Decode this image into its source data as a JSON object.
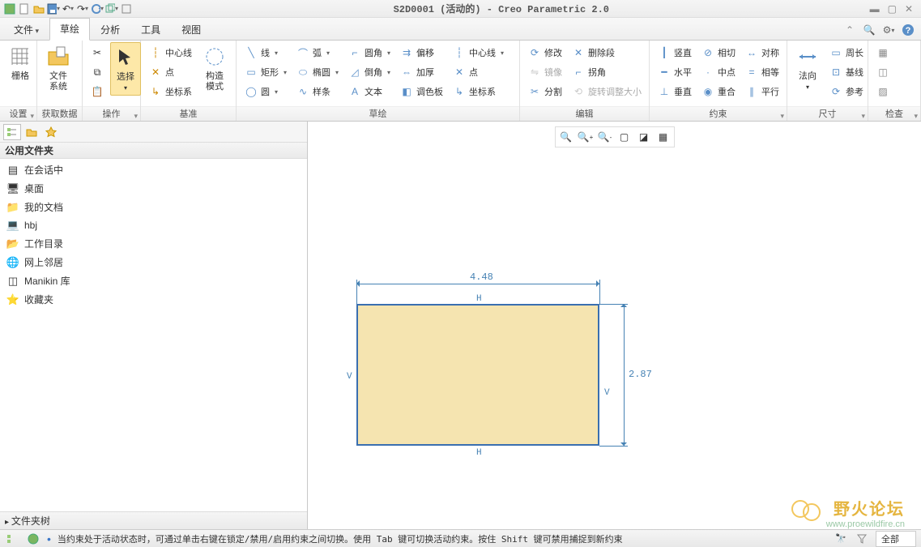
{
  "title": "S2D0001 (活动的) - Creo Parametric 2.0",
  "tabs": [
    "文件",
    "草绘",
    "分析",
    "工具",
    "视图"
  ],
  "active_tab_index": 1,
  "ribbon": {
    "groups": [
      {
        "label": "设置",
        "items_big": [
          {
            "name": "grid",
            "label": "栅格"
          }
        ]
      },
      {
        "label": "获取数据",
        "items_big": [
          {
            "name": "file-system",
            "label": "文件\n系统"
          }
        ]
      },
      {
        "label": "操作",
        "items_big": [
          {
            "name": "select",
            "label": "选择"
          }
        ],
        "small_col": [
          {
            "name": "cut",
            "icon": "✂"
          },
          {
            "name": "copy",
            "icon": "⧉"
          },
          {
            "name": "paste",
            "icon": "📋"
          }
        ]
      },
      {
        "label": "基准",
        "col1": [
          {
            "name": "centerline",
            "label": "中心线",
            "icon": "┆"
          },
          {
            "name": "point",
            "label": "点",
            "icon": "✕"
          },
          {
            "name": "coord-sys",
            "label": "坐标系",
            "icon": "↳"
          }
        ],
        "big": {
          "name": "construct-mode",
          "label": "构造\n模式"
        }
      },
      {
        "label": "草绘",
        "cols": [
          [
            {
              "name": "line",
              "label": "线",
              "icon": "╲",
              "dd": true
            },
            {
              "name": "rect",
              "label": "矩形",
              "icon": "▭",
              "dd": true
            },
            {
              "name": "circle",
              "label": "圆",
              "icon": "◯",
              "dd": true
            }
          ],
          [
            {
              "name": "arc",
              "label": "弧",
              "icon": "⌒",
              "dd": true
            },
            {
              "name": "ellipse",
              "label": "椭圆",
              "icon": "⬭",
              "dd": true
            },
            {
              "name": "spline",
              "label": "样条",
              "icon": "∿"
            }
          ],
          [
            {
              "name": "fillet",
              "label": "圆角",
              "icon": "⌐",
              "dd": true
            },
            {
              "name": "chamfer",
              "label": "倒角",
              "icon": "◿",
              "dd": true
            },
            {
              "name": "text",
              "label": "文本",
              "icon": "A"
            }
          ],
          [
            {
              "name": "offset",
              "label": "偏移",
              "icon": "⇉"
            },
            {
              "name": "thicken",
              "label": "加厚",
              "icon": "⇔"
            },
            {
              "name": "palette",
              "label": "调色板",
              "icon": "◧"
            }
          ],
          [
            {
              "name": "centerline2",
              "label": "中心线",
              "icon": "┆",
              "dd": true
            },
            {
              "name": "point2",
              "label": "点",
              "icon": "✕"
            },
            {
              "name": "coord2",
              "label": "坐标系",
              "icon": "↳"
            }
          ]
        ]
      },
      {
        "label": "编辑",
        "cols": [
          [
            {
              "name": "modify",
              "label": "修改",
              "icon": "⟳"
            },
            {
              "name": "mirror",
              "label": "镜像",
              "icon": "⇋",
              "disabled": true
            },
            {
              "name": "divide",
              "label": "分割",
              "icon": "✂"
            }
          ],
          [
            {
              "name": "delete-seg",
              "label": "删除段",
              "icon": "✕"
            },
            {
              "name": "corner",
              "label": "拐角",
              "icon": "⌐"
            },
            {
              "name": "rotate-resize",
              "label": "旋转调整大小",
              "icon": "⟲",
              "disabled": true
            }
          ]
        ]
      },
      {
        "label": "约束",
        "cols": [
          [
            {
              "name": "vertical",
              "label": "竖直",
              "icon": "┃"
            },
            {
              "name": "horizontal",
              "label": "水平",
              "icon": "━"
            },
            {
              "name": "perpendicular",
              "label": "垂直",
              "icon": "⊥"
            }
          ],
          [
            {
              "name": "tangent",
              "label": "相切",
              "icon": "⊘"
            },
            {
              "name": "midpoint",
              "label": "中点",
              "icon": "·"
            },
            {
              "name": "coincident",
              "label": "重合",
              "icon": "◉"
            }
          ],
          [
            {
              "name": "symmetric",
              "label": "对称",
              "icon": "↔"
            },
            {
              "name": "equal",
              "label": "相等",
              "icon": "="
            },
            {
              "name": "parallel",
              "label": "平行",
              "icon": "∥"
            }
          ]
        ]
      },
      {
        "label": "尺寸",
        "big": {
          "name": "normal-dim",
          "label": "法向"
        },
        "col": [
          {
            "name": "perimeter",
            "label": "周长",
            "icon": "▭"
          },
          {
            "name": "baseline",
            "label": "基线",
            "icon": "⊡"
          },
          {
            "name": "reference",
            "label": "参考",
            "icon": "⟳"
          }
        ]
      },
      {
        "label": "检查",
        "col": [
          {
            "name": "inspect1",
            "icon": "▦"
          },
          {
            "name": "inspect2",
            "icon": "◫"
          },
          {
            "name": "inspect3",
            "icon": "▨"
          }
        ]
      }
    ]
  },
  "sidebar": {
    "header": "公用文件夹",
    "items": [
      {
        "name": "in-session",
        "label": "在会话中",
        "icon": "▤"
      },
      {
        "name": "desktop",
        "label": "桌面",
        "icon": "🖥"
      },
      {
        "name": "my-docs",
        "label": "我的文档",
        "icon": "📁"
      },
      {
        "name": "hbj",
        "label": "hbj",
        "icon": "💻"
      },
      {
        "name": "working-dir",
        "label": "工作目录",
        "icon": "📂"
      },
      {
        "name": "network",
        "label": "网上邻居",
        "icon": "🌐"
      },
      {
        "name": "manikin",
        "label": "Manikin 库",
        "icon": "◫"
      },
      {
        "name": "favorites",
        "label": "收藏夹",
        "icon": "⭐"
      }
    ],
    "footer": "文件夹树"
  },
  "sketch": {
    "width_dim": "4.48",
    "height_dim": "2.87",
    "h_mark": "H",
    "v_mark": "V"
  },
  "statusbar": {
    "msg": "当约束处于活动状态时，可通过单击右键在锁定/禁用/启用约束之间切换。使用 Tab 键可切换活动约束。按住 Shift 键可禁用捕捉到新约束",
    "all": "全部"
  },
  "watermark": {
    "line1": "野火论坛",
    "line2": "www.proewildfire.cn"
  }
}
